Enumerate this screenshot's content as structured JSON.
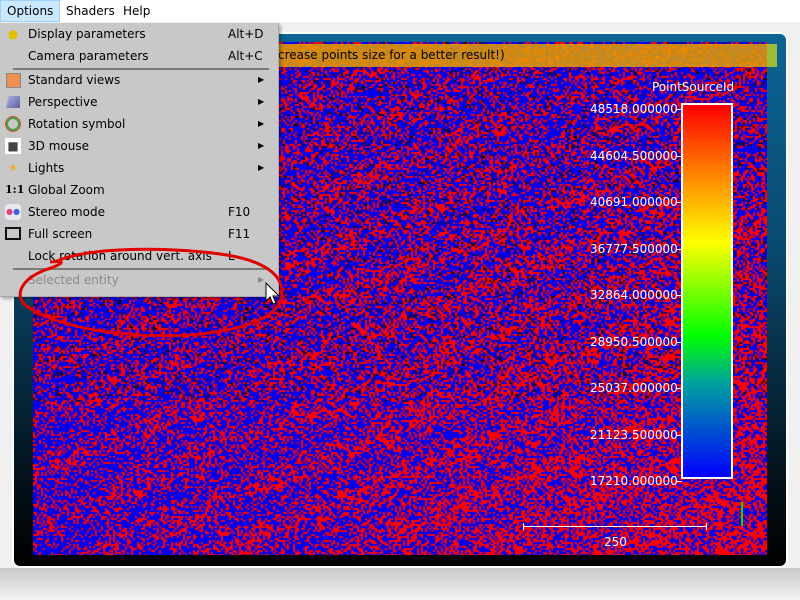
{
  "menubar": {
    "items": [
      {
        "label": "Options",
        "active": true
      },
      {
        "label": "Shaders"
      },
      {
        "label": "Help"
      }
    ]
  },
  "banner": {
    "text": "crease points size for a better result!)"
  },
  "legend": {
    "title": "PointSourceId",
    "ticks": [
      "48518.000000",
      "44604.500000",
      "40691.000000",
      "36777.500000",
      "32864.000000",
      "28950.500000",
      "25037.000000",
      "21123.500000",
      "17210.000000"
    ]
  },
  "scale": {
    "label": "250"
  },
  "options_menu": {
    "items": [
      {
        "label": "Display parameters",
        "shortcut": "Alt+D",
        "icon": "lightbulb-icon"
      },
      {
        "label": "Camera parameters",
        "shortcut": "Alt+C",
        "icon": ""
      },
      {
        "label": "Standard views",
        "submenu": true,
        "icon": "cube-icon"
      },
      {
        "label": "Perspective",
        "submenu": true,
        "icon": "perspective-icon"
      },
      {
        "label": "Rotation symbol",
        "submenu": true,
        "icon": "rotation-symbol-icon"
      },
      {
        "label": "3D mouse",
        "submenu": true,
        "icon": "3d-mouse-icon"
      },
      {
        "label": "Lights",
        "submenu": true,
        "icon": "sun-icon"
      },
      {
        "label": "Global Zoom",
        "icon": "global-zoom-icon",
        "icon_text": "1:1"
      },
      {
        "label": "Stereo mode",
        "shortcut": "F10",
        "icon": "stereo-icon"
      },
      {
        "label": "Full screen",
        "shortcut": "F11",
        "icon": "fullscreen-icon"
      },
      {
        "label": "Lock rotation around vert. axis",
        "shortcut": "L",
        "icon": ""
      },
      {
        "label": "Selected entity",
        "submenu": true,
        "disabled": true,
        "icon": ""
      }
    ]
  },
  "colors": {
    "cloud_red": "#ff0000",
    "cloud_blue": "#0000ee",
    "annotation": "#e00000",
    "banner": "#e6a000"
  }
}
